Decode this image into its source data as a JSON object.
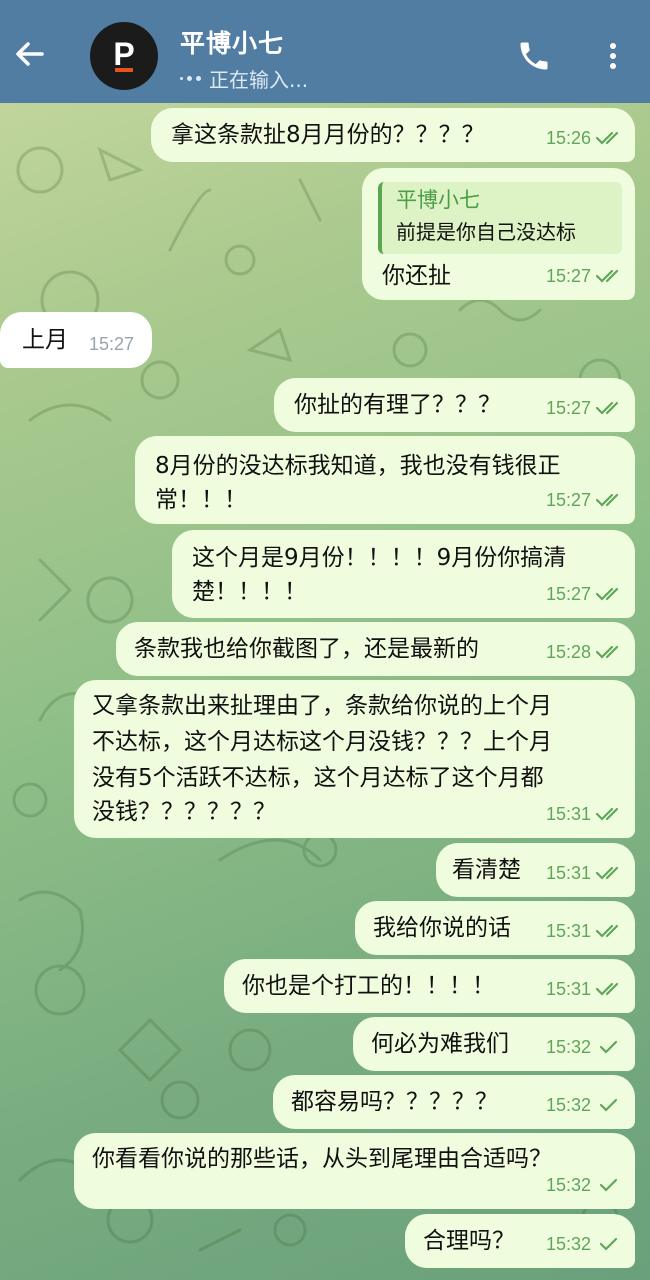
{
  "header": {
    "back_icon": "arrow-left-icon",
    "avatar_letter": "P",
    "avatar_colors": {
      "bg": "#1b1b1b",
      "letter": "#ffffff",
      "bar": "#e8521c"
    },
    "name": "平博小七",
    "status": "正在输入...",
    "call_icon": "phone-icon",
    "menu_icon": "more-vertical-icon",
    "bg_color": "#517da2"
  },
  "messages": [
    {
      "dir": "out",
      "text": "拿这条款扯8月月份的？？？？",
      "time": "15:26",
      "ticks": "double"
    },
    {
      "dir": "out",
      "reply_to_name": "平博小七",
      "reply_to_text": "前提是你自己没达标",
      "text": "你还扯",
      "time": "15:27",
      "ticks": "double"
    },
    {
      "dir": "in",
      "text": "上月",
      "time": "15:27"
    },
    {
      "dir": "out",
      "text": "你扯的有理了？？？",
      "time": "15:27",
      "ticks": "double"
    },
    {
      "dir": "out",
      "lines": [
        "8月份的没达标我知道，我也没有钱很正",
        "常！！！"
      ],
      "time": "15:27",
      "ticks": "double"
    },
    {
      "dir": "out",
      "lines": [
        "这个月是9月份！！！！9月份你搞清",
        "楚！！！！"
      ],
      "time": "15:27",
      "ticks": "double"
    },
    {
      "dir": "out",
      "text": "条款我也给你截图了，还是最新的",
      "time": "15:28",
      "ticks": "double"
    },
    {
      "dir": "out",
      "lines": [
        "又拿条款出来扯理由了，条款给你说的上个月",
        "不达标，这个月达标这个月没钱？？？上个月",
        "没有5个活跃不达标，这个月达标了这个月都",
        "没钱？？？？？？"
      ],
      "time": "15:31",
      "ticks": "double"
    },
    {
      "dir": "out",
      "text": "看清楚",
      "time": "15:31",
      "ticks": "double"
    },
    {
      "dir": "out",
      "text": "我给你说的话",
      "time": "15:31",
      "ticks": "double"
    },
    {
      "dir": "out",
      "text": "你也是个打工的！！！！",
      "time": "15:31",
      "ticks": "double"
    },
    {
      "dir": "out",
      "text": "何必为难我们",
      "time": "15:32",
      "ticks": "single"
    },
    {
      "dir": "out",
      "text": "都容易吗？？？？？",
      "time": "15:32",
      "ticks": "single"
    },
    {
      "dir": "out",
      "text": "你看看你说的那些话，从头到尾理由合适吗？",
      "time": "15:32",
      "ticks": "single"
    },
    {
      "dir": "out",
      "text": "合理吗？",
      "time": "15:32",
      "ticks": "single"
    }
  ]
}
